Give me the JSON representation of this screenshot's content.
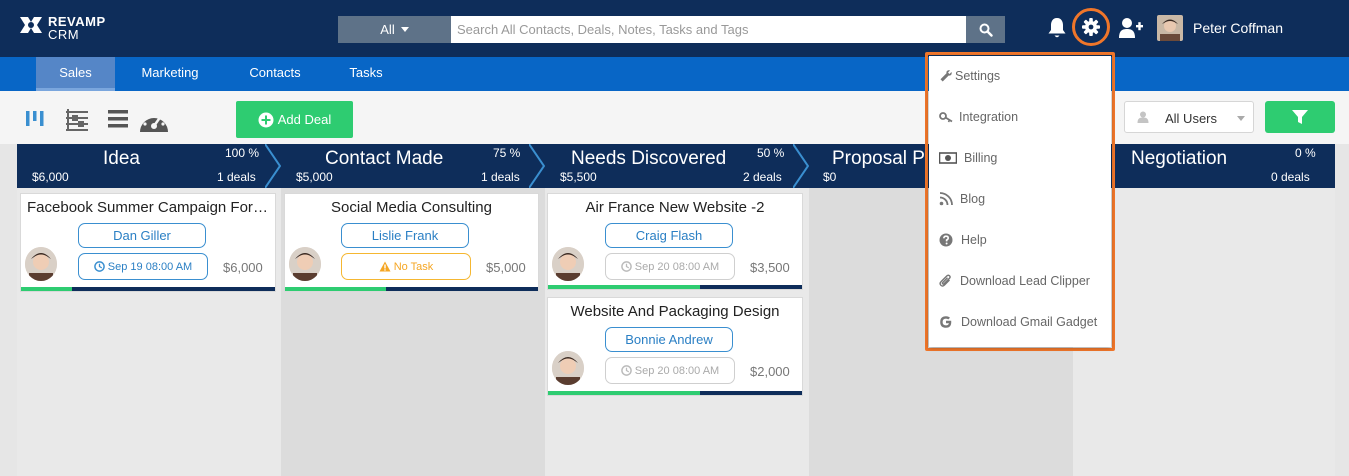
{
  "app": {
    "logo_line1": "REVAMP",
    "logo_line2": "CRM",
    "user_name": "Peter Coffman"
  },
  "search": {
    "filter_label": "All",
    "placeholder": "Search All Contacts, Deals, Notes, Tasks and Tags"
  },
  "nav": {
    "tabs": [
      {
        "label": "Sales",
        "active": true
      },
      {
        "label": "Marketing"
      },
      {
        "label": "Contacts"
      },
      {
        "label": "Tasks"
      }
    ]
  },
  "toolbar": {
    "add_deal_label": "Add Deal",
    "users_filter_label": "All Users"
  },
  "stages": [
    {
      "name": "Idea",
      "percent": "100 %",
      "amount": "$6,000",
      "count": "1 deals"
    },
    {
      "name": "Contact Made",
      "percent": "75 %",
      "amount": "$5,000",
      "count": "1 deals"
    },
    {
      "name": "Needs Discovered",
      "percent": "50 %",
      "amount": "$5,500",
      "count": "2 deals"
    },
    {
      "name": "Proposal P",
      "percent": "",
      "amount": "$0",
      "count": ""
    },
    {
      "name": "Negotiation",
      "percent": "0 %",
      "amount": "",
      "count": "0 deals"
    }
  ],
  "deals": [
    {
      "title": "Facebook Summer Campaign For ...",
      "contact": "Dan Giller",
      "task": "Sep 19 08:00 AM",
      "amount": "$6,000",
      "progress": 0.2
    },
    {
      "title": "Social Media Consulting",
      "contact": "Lislie Frank",
      "task": "No Task",
      "amount": "$5,000",
      "progress": 0.4
    },
    {
      "title": "Air France New Website -2",
      "contact": "Craig Flash",
      "task": "Sep 20 08:00 AM",
      "amount": "$3,500",
      "progress": 0.6
    },
    {
      "title": "Website And Packaging Design",
      "contact": "Bonnie Andrew",
      "task": "Sep 20 08:00 AM",
      "amount": "$2,000",
      "progress": 0.6
    }
  ],
  "settings_menu": {
    "items": [
      {
        "label": "Settings",
        "icon": "wrench-icon"
      },
      {
        "label": "Integration",
        "icon": "key-icon"
      },
      {
        "label": "Billing",
        "icon": "money-icon"
      },
      {
        "label": "Blog",
        "icon": "rss-icon"
      },
      {
        "label": "Help",
        "icon": "question-circle-icon"
      },
      {
        "label": "Download Lead Clipper",
        "icon": "paperclip-icon"
      },
      {
        "label": "Download Gmail Gadget",
        "icon": "google-icon"
      }
    ]
  },
  "colors": {
    "topbar": "#0e2d5a",
    "navbar": "#0866c6",
    "accent_green": "#2ecc71",
    "highlight_orange": "#f0762a",
    "link_blue": "#2a7fc4"
  }
}
